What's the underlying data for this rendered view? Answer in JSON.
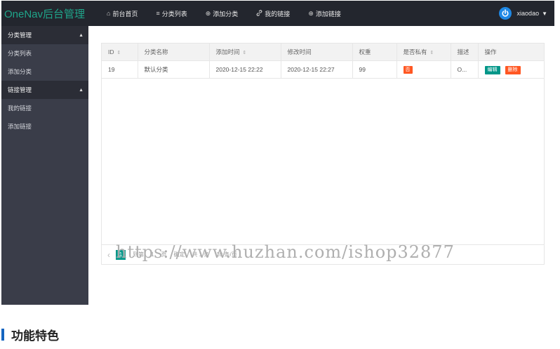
{
  "header": {
    "logo": "OneNav后台管理",
    "nav": [
      {
        "icon": "home-icon",
        "glyph": "⌂",
        "label": "前台首页"
      },
      {
        "icon": "list-icon",
        "glyph": "≡",
        "label": "分类列表"
      },
      {
        "icon": "add-circle-icon",
        "glyph": "⊕",
        "label": "添加分类"
      },
      {
        "icon": "link-icon",
        "glyph": "🔗",
        "label": "我的链接"
      },
      {
        "icon": "add-circle-icon",
        "glyph": "⊕",
        "label": "添加链接"
      }
    ],
    "user": "xiaodao"
  },
  "sidebar": {
    "groups": [
      {
        "label": "分类管理",
        "items": [
          "分类列表",
          "添加分类"
        ]
      },
      {
        "label": "链接管理",
        "items": [
          "我的链接",
          "添加链接"
        ]
      }
    ]
  },
  "table": {
    "columns": [
      "ID",
      "分类名称",
      "添加时间",
      "修改时间",
      "权重",
      "是否私有",
      "描述",
      "操作"
    ],
    "rows": [
      {
        "id": "19",
        "name": "默认分类",
        "added": "2020-12-15 22:22",
        "modified": "2020-12-15 22:27",
        "weight": "99",
        "private": "否",
        "desc": "O...",
        "edit": "编辑",
        "delete": "删除"
      }
    ],
    "pager": {
      "prev": "‹",
      "current": "1",
      "goto": "到第",
      "page_value": "1",
      "page_unit": "页",
      "confirm": "确定",
      "total": "共 1 条",
      "per_page": "10 条/页"
    }
  },
  "watermark": "https://www.huzhan.com/ishop32877",
  "section": {
    "title": "功能特色"
  },
  "colors": {
    "header_bg": "#23262e",
    "sidebar_bg": "#3a3d49",
    "accent_green": "#009688",
    "danger_orange": "#ff5722",
    "brand_blue": "#1565c0"
  }
}
